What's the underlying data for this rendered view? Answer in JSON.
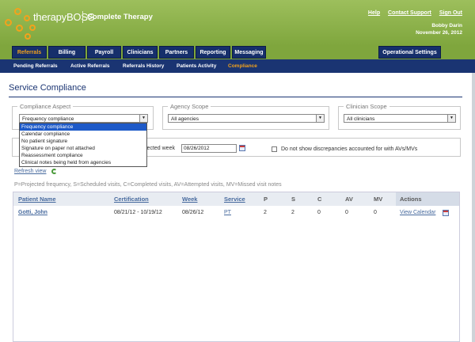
{
  "header": {
    "logo": "therapyBOSS",
    "company": "Complete Therapy",
    "links": [
      "Help",
      "Contact Support",
      "Sign Out"
    ],
    "user_name": "Bobby Darin",
    "date": "November 26, 2012"
  },
  "main_nav": {
    "tabs": [
      "Referrals",
      "Billing",
      "Payroll",
      "Clinicians",
      "Partners",
      "Reporting",
      "Messaging"
    ],
    "active": "Referrals",
    "right_tab": "Operational Settings"
  },
  "sub_nav": {
    "items": [
      "Pending Referrals",
      "Active Referrals",
      "Referrals History",
      "Patients Activity",
      "Compliance"
    ],
    "active": "Compliance"
  },
  "page": {
    "title": "Service Compliance"
  },
  "filters": {
    "compliance_aspect": {
      "legend": "Compliance Aspect",
      "value": "Frequency compliance",
      "options": [
        "Frequency compliance",
        "Calendar compliance",
        "No patient signature",
        "Signature on paper not attached",
        "Reassessment compliance",
        "Clinical notes being held from agencies"
      ]
    },
    "agency_scope": {
      "legend": "Agency Scope",
      "value": "All agencies"
    },
    "clinician_scope": {
      "legend": "Clinician Scope",
      "value": "All clinicians"
    },
    "week_label": "lected week",
    "week_value": "08/26/2012",
    "discrepancy_label": "Do not show discrepancies accounted for with AVs/MVs",
    "refresh_label": "Refresh view"
  },
  "legend_text": "P=Projected frequency, S=Scheduled visits, C=Completed visits, AV=Attempted visits, MV=Missed visit notes",
  "table": {
    "headers": [
      "Patient Name",
      "Certification",
      "Week",
      "Service",
      "P",
      "S",
      "C",
      "AV",
      "MV",
      "Actions"
    ],
    "rows": [
      {
        "patient": "Gotti, John",
        "certification": "08/21/12 - 10/19/12",
        "week": "08/26/12",
        "service": "PT",
        "p": "2",
        "s": "2",
        "c": "0",
        "av": "0",
        "mv": "0",
        "action": "View Calendar"
      }
    ]
  },
  "colors": {
    "header_green": "#8db54c",
    "nav_navy": "#162f6b",
    "accent_orange": "#f3a21c",
    "link_blue": "#476a9e"
  }
}
